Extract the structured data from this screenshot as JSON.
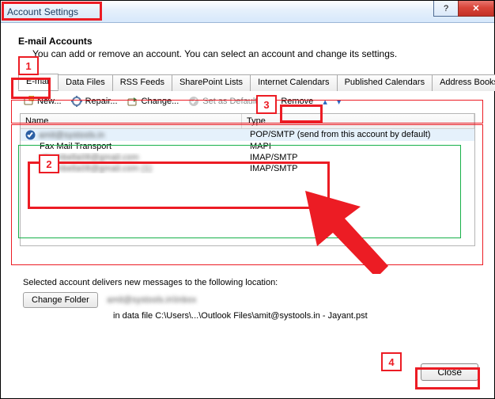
{
  "window": {
    "title": "Account Settings"
  },
  "header": {
    "heading": "E-mail Accounts",
    "sub": "You can add or remove an account. You can select an account and change its settings."
  },
  "tabs": [
    "E-mail",
    "Data Files",
    "RSS Feeds",
    "SharePoint Lists",
    "Internet Calendars",
    "Published Calendars",
    "Address Books"
  ],
  "toolbar": {
    "new": "New...",
    "repair": "Repair...",
    "change": "Change...",
    "default": "Set as Default",
    "remove": "Remove"
  },
  "list": {
    "cols": [
      "Name",
      "Type"
    ],
    "rows": [
      {
        "name": "amit@systools.in",
        "type": "POP/SMTP (send from this account by default)",
        "default": true,
        "blur": true
      },
      {
        "name": "Fax Mail Transport",
        "type": "MAPI",
        "default": false,
        "blur": false
      },
      {
        "name": "alisonbella08@gmail.com",
        "type": "IMAP/SMTP",
        "default": false,
        "blur": true
      },
      {
        "name": "alisonbella08@gmail.com (1)",
        "type": "IMAP/SMTP",
        "default": false,
        "blur": true
      }
    ]
  },
  "footer": {
    "line": "Selected account delivers new messages to the following location:",
    "change_folder": "Change Folder",
    "loc_main": "amit@systools.in\\Inbox",
    "loc_sub": "in data file C:\\Users\\...\\Outlook Files\\amit@systools.in - Jayant.pst"
  },
  "buttons": {
    "close": "Close"
  },
  "annotations": {
    "1": "1",
    "2": "2",
    "3": "3",
    "4": "4"
  }
}
